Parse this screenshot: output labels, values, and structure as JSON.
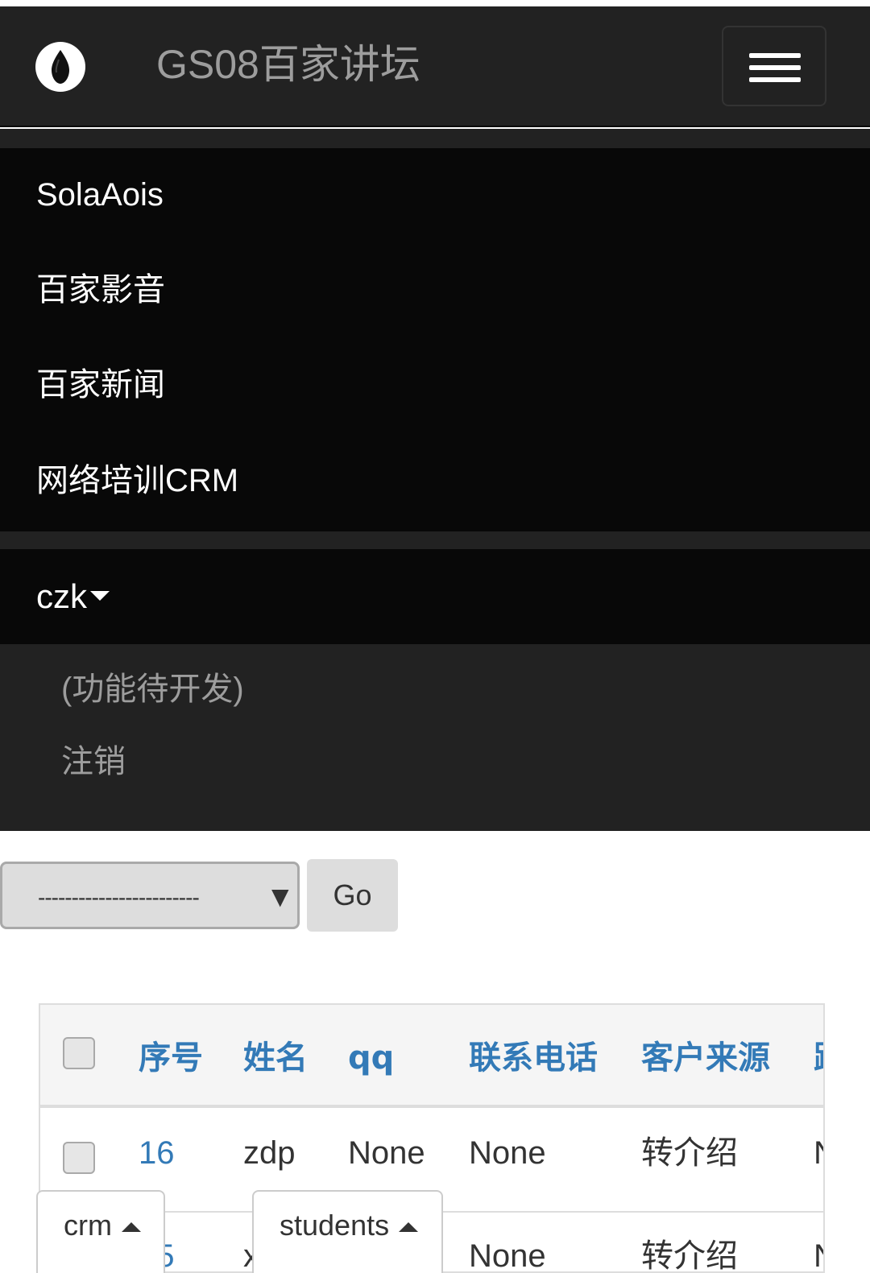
{
  "navbar": {
    "brand": "GS08百家讲坛",
    "logo_icon": "ink-drop-icon",
    "toggle_icon": "hamburger-icon"
  },
  "menu": {
    "items": [
      {
        "label": "SolaAois"
      },
      {
        "label": "百家影音"
      },
      {
        "label": "百家新闻"
      },
      {
        "label": "网络培训CRM"
      }
    ]
  },
  "user": {
    "name": "czk",
    "caret_icon": "caret-down-icon",
    "dropdown": [
      {
        "label": "(功能待开发)"
      },
      {
        "label": "注销"
      }
    ]
  },
  "actions": {
    "select_value": "------------------------",
    "go_label": "Go"
  },
  "table": {
    "columns": [
      "序号",
      "姓名",
      "qq",
      "联系电话",
      "客户来源",
      "跟"
    ],
    "rows": [
      {
        "cells": [
          "16",
          "zdp",
          "None",
          "None",
          "转介绍",
          "N"
        ]
      },
      {
        "cells": [
          "15",
          "x",
          "",
          "None",
          "转介绍",
          "N"
        ]
      }
    ]
  },
  "tabs": [
    {
      "label": "crm"
    },
    {
      "label": "students"
    }
  ],
  "colors": {
    "navbar_bg": "#222222",
    "menu_bg": "#080808",
    "link": "#337ab7",
    "muted_text": "#9d9d9d"
  }
}
